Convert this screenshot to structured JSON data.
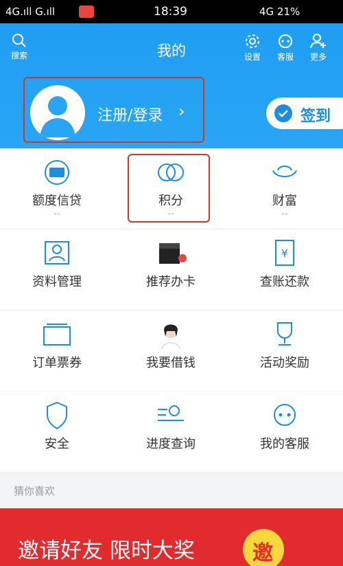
{
  "status_bar": {
    "left": "4G.ıll G.ıll",
    "time": "18:39",
    "right": "4G 21%"
  },
  "header": {
    "title": "我的",
    "search_label": "搜索",
    "settings_label": "设置",
    "service_label": "客服",
    "more_label": "更多",
    "login_label": "注册/登录",
    "checkin_label": "签到"
  },
  "grid": {
    "rows": [
      [
        {
          "label": "额度信贷",
          "sub": "--"
        },
        {
          "label": "积分",
          "sub": "--"
        },
        {
          "label": "财富",
          "sub": "--"
        }
      ],
      [
        {
          "label": "资料管理"
        },
        {
          "label": "推荐办卡"
        },
        {
          "label": "查账还款"
        }
      ],
      [
        {
          "label": "订单票券"
        },
        {
          "label": "我要借钱"
        },
        {
          "label": "活动奖励"
        }
      ],
      [
        {
          "label": "安全"
        },
        {
          "label": "进度查询"
        },
        {
          "label": "我的客服"
        }
      ]
    ]
  },
  "guess_label": "猜你喜欢",
  "banner": {
    "text": "邀请好友 限时大奖",
    "coin": "邀"
  },
  "colors": {
    "header": "#2aa5f5",
    "accent": "#1d8de0",
    "banner": "#e22b2f"
  }
}
